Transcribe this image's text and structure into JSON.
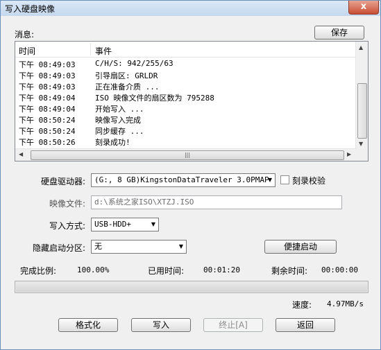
{
  "window": {
    "title": "写入硬盘映像",
    "close_label": "x"
  },
  "messages": {
    "label": "消息:",
    "save_label": "保存"
  },
  "log": {
    "columns": {
      "time": "时间",
      "event": "事件"
    },
    "rows": [
      {
        "time": "下午 08:49:03",
        "event": "C/H/S: 942/255/63"
      },
      {
        "time": "下午 08:49:03",
        "event": "引导扇区: GRLDR"
      },
      {
        "time": "下午 08:49:03",
        "event": "正在准备介质 ..."
      },
      {
        "time": "下午 08:49:04",
        "event": "ISO 映像文件的扇区数为 795288"
      },
      {
        "time": "下午 08:49:04",
        "event": "开始写入 ..."
      },
      {
        "time": "下午 08:50:24",
        "event": "映像写入完成"
      },
      {
        "time": "下午 08:50:24",
        "event": "同步缓存 ..."
      },
      {
        "time": "下午 08:50:26",
        "event": "刻录成功!"
      }
    ],
    "hscroll_grip": "|||"
  },
  "drive": {
    "label": "硬盘驱动器:",
    "value": "(G:, 8 GB)KingstonDataTraveler 3.0PMAP",
    "verify_label": "刻录校验"
  },
  "image_file": {
    "label": "映像文件:",
    "value": "d:\\系统之家ISO\\XTZJ.ISO"
  },
  "write_mode": {
    "label": "写入方式:",
    "value": "USB-HDD+"
  },
  "hidden_partition": {
    "label": "隐藏启动分区:",
    "value": "无",
    "quick_boot_label": "便捷启动"
  },
  "stats": {
    "done_label": "完成比例:",
    "done_value": "100.00%",
    "elapsed_label": "已用时间:",
    "elapsed_value": "00:01:20",
    "remaining_label": "剩余时间:",
    "remaining_value": "00:00:00",
    "speed_label": "速度:",
    "speed_value": "4.97MB/s"
  },
  "progress": {
    "fraction": 1.0
  },
  "buttons": {
    "format": "格式化",
    "write": "写入",
    "abort": "终止[A]",
    "back": "返回"
  }
}
